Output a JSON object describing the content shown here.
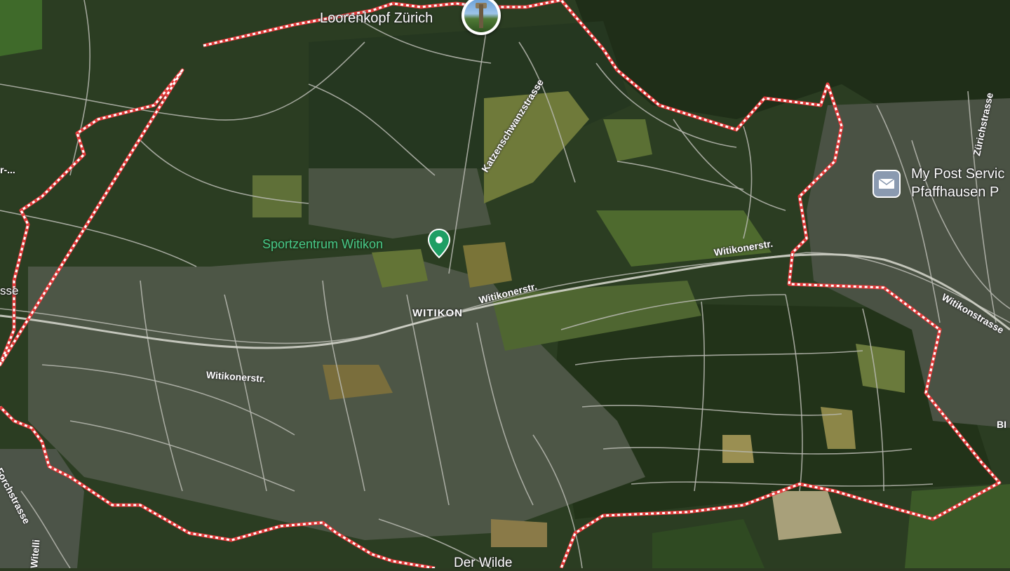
{
  "map": {
    "type": "satellite",
    "boundary_color": "#e23b3b",
    "labels": {
      "loorenkopf": "Loorenkopf Zürich",
      "sportzentrum": "Sportzentrum Witikon",
      "district": "WITIKON",
      "witikonerstr_east": "Witikonerstr.",
      "witikonerstr_center": "Witikonerstr.",
      "witikonerstr_west": "Witikonerstr.",
      "katzenschwanzstrasse": "Katzenschwanzstrasse",
      "zurichstrasse": "Zürichstrasse",
      "mypost": "My Post Servic",
      "pfaffhausen": "Pfaffhausen P",
      "witikonstrasse": "Witikonstrasse",
      "forchstrasse": "Forchstrasse",
      "der_wilde": "Der Wilde",
      "left_sse": "sse",
      "left_r": "r-...",
      "right_bi": "BI",
      "witelli": "Witelli"
    },
    "icons": {
      "loorenkopf_photo": "tower-photo-icon",
      "sportzentrum_pin": "green-place-pin-icon",
      "post_icon": "mail-icon"
    }
  }
}
